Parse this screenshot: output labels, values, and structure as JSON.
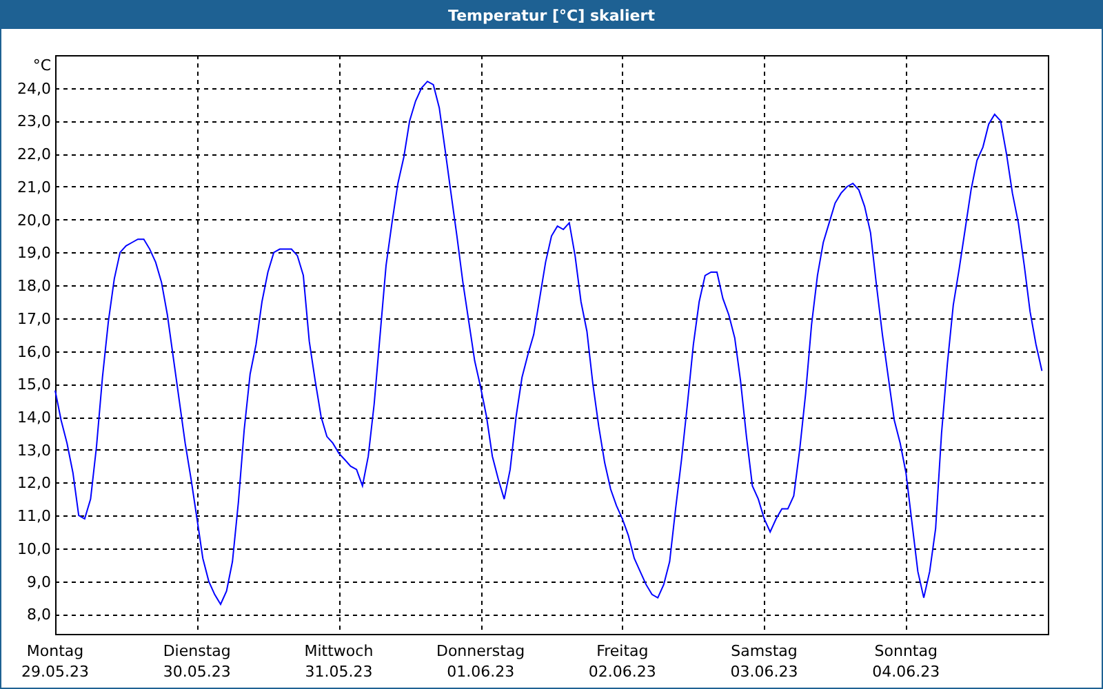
{
  "window": {
    "title": "Temperatur [°C] skaliert"
  },
  "chart": {
    "days": [
      "Montag",
      "Dienstag",
      "Mittwoch",
      "Donnerstag",
      "Freitag",
      "Samstag",
      "Sonntag"
    ],
    "chart_data": {
      "type": "line",
      "grid": true,
      "ylabel": "°C",
      "ylim": [
        7.4,
        25.0
      ],
      "yticks": [
        {
          "value": 8,
          "label": "8,0"
        },
        {
          "value": 9,
          "label": "9,0"
        },
        {
          "value": 10,
          "label": "10,0"
        },
        {
          "value": 11,
          "label": "11,0"
        },
        {
          "value": 12,
          "label": "12,0"
        },
        {
          "value": 13,
          "label": "13,0"
        },
        {
          "value": 14,
          "label": "14,0"
        },
        {
          "value": 15,
          "label": "15,0"
        },
        {
          "value": 16,
          "label": "16,0"
        },
        {
          "value": 17,
          "label": "17,0"
        },
        {
          "value": 18,
          "label": "18,0"
        },
        {
          "value": 19,
          "label": "19,0"
        },
        {
          "value": 20,
          "label": "20,0"
        },
        {
          "value": 21,
          "label": "21,0"
        },
        {
          "value": 22,
          "label": "22,0"
        },
        {
          "value": 23,
          "label": "23,0"
        },
        {
          "value": 24,
          "label": "24,0"
        }
      ],
      "categories": [
        "29.05.23",
        null,
        null,
        null,
        null,
        null,
        null,
        null,
        null,
        null,
        null,
        null,
        null,
        null,
        null,
        null,
        null,
        null,
        null,
        null,
        null,
        null,
        null,
        null,
        "30.05.23",
        null,
        null,
        null,
        null,
        null,
        null,
        null,
        null,
        null,
        null,
        null,
        null,
        null,
        null,
        null,
        null,
        null,
        null,
        null,
        null,
        null,
        null,
        null,
        "31.05.23",
        null,
        null,
        null,
        null,
        null,
        null,
        null,
        null,
        null,
        null,
        null,
        null,
        null,
        null,
        null,
        null,
        null,
        null,
        null,
        null,
        null,
        null,
        null,
        "01.06.23",
        null,
        null,
        null,
        null,
        null,
        null,
        null,
        null,
        null,
        null,
        null,
        null,
        null,
        null,
        null,
        null,
        null,
        null,
        null,
        null,
        null,
        null,
        null,
        "02.06.23",
        null,
        null,
        null,
        null,
        null,
        null,
        null,
        null,
        null,
        null,
        null,
        null,
        null,
        null,
        null,
        null,
        null,
        null,
        null,
        null,
        null,
        null,
        null,
        "03.06.23",
        null,
        null,
        null,
        null,
        null,
        null,
        null,
        null,
        null,
        null,
        null,
        null,
        null,
        null,
        null,
        null,
        null,
        null,
        null,
        null,
        null,
        null,
        null,
        "04.06.23",
        null,
        null,
        null,
        null,
        null,
        null,
        null,
        null,
        null,
        null,
        null,
        null,
        null,
        null,
        null,
        null,
        null,
        null,
        null,
        null,
        null,
        null,
        null
      ],
      "series": [
        {
          "color": "#0000ff",
          "values": [
            14.8,
            13.9,
            13.2,
            12.3,
            11.0,
            10.9,
            11.5,
            13.1,
            15.2,
            16.9,
            18.2,
            19.0,
            19.2,
            19.3,
            19.4,
            19.4,
            19.1,
            18.7,
            18.1,
            17.1,
            15.8,
            14.5,
            13.2,
            12.1,
            10.9,
            9.7,
            9.0,
            8.6,
            8.3,
            8.7,
            9.6,
            11.4,
            13.6,
            15.3,
            16.2,
            17.5,
            18.4,
            19.0,
            19.1,
            19.1,
            19.1,
            18.9,
            18.3,
            16.3,
            15.1,
            14.0,
            13.4,
            13.2,
            12.9,
            12.7,
            12.5,
            12.4,
            11.9,
            12.8,
            14.4,
            16.5,
            18.6,
            19.9,
            21.1,
            21.9,
            23.0,
            23.6,
            24.0,
            24.2,
            24.1,
            23.4,
            22.1,
            20.8,
            19.5,
            18.1,
            16.9,
            15.7,
            14.9,
            14.0,
            12.8,
            12.1,
            11.5,
            12.4,
            14.0,
            15.2,
            15.9,
            16.5,
            17.6,
            18.7,
            19.5,
            19.8,
            19.7,
            19.9,
            18.9,
            17.5,
            16.6,
            15.0,
            13.7,
            12.6,
            11.8,
            11.3,
            10.9,
            10.4,
            9.7,
            9.3,
            8.9,
            8.6,
            8.5,
            8.9,
            9.6,
            11.2,
            12.7,
            14.4,
            16.2,
            17.5,
            18.3,
            18.4,
            18.4,
            17.6,
            17.1,
            16.4,
            15.1,
            13.4,
            11.9,
            11.5,
            10.9,
            10.5,
            10.9,
            11.2,
            11.2,
            11.6,
            13.0,
            14.7,
            16.8,
            18.3,
            19.3,
            19.9,
            20.5,
            20.8,
            21.0,
            21.1,
            20.9,
            20.4,
            19.6,
            18.0,
            16.5,
            15.2,
            13.9,
            13.2,
            12.3,
            10.8,
            9.3,
            8.5,
            9.3,
            10.6,
            13.5,
            15.6,
            17.4,
            18.5,
            19.7,
            20.9,
            21.8,
            22.2,
            22.9,
            23.2,
            23.0,
            22.0,
            20.8,
            19.9,
            18.6,
            17.2,
            16.2,
            15.4
          ]
        }
      ]
    }
  }
}
